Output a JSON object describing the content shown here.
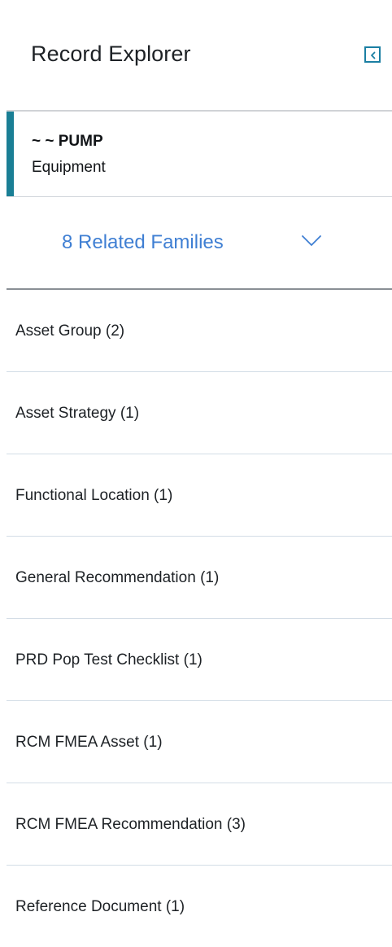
{
  "header": {
    "title": "Record Explorer",
    "collapse_icon": "chevron-left-icon"
  },
  "record": {
    "name": "~ ~ PUMP",
    "type": "Equipment"
  },
  "related": {
    "label": "8 Related Families",
    "toggle_icon": "chevron-down-icon"
  },
  "families": [
    {
      "label": "Asset Group (2)"
    },
    {
      "label": "Asset Strategy (1)"
    },
    {
      "label": "Functional Location (1)"
    },
    {
      "label": "General Recommendation (1)"
    },
    {
      "label": "PRD Pop Test Checklist (1)"
    },
    {
      "label": "RCM FMEA Asset (1)"
    },
    {
      "label": "RCM FMEA Recommendation (3)"
    },
    {
      "label": "Reference Document (1)"
    }
  ],
  "colors": {
    "accent": "#1a7f95",
    "link": "#3f7fd3",
    "button_border": "#1b7fa3"
  }
}
